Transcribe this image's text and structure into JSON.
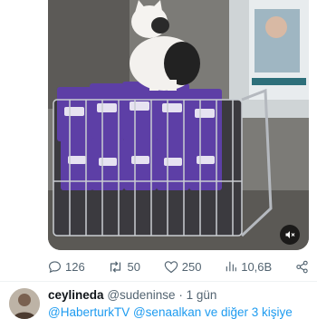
{
  "tweet": {
    "media": {
      "kind": "video",
      "scene": "cat-on-shopping-cart"
    },
    "actions": {
      "replies": "126",
      "reposts": "50",
      "likes": "250",
      "views": "10,6B"
    }
  },
  "reply": {
    "display_name": "ceylineda",
    "handle": "@sudeninse",
    "separator": "·",
    "time": "1 gün",
    "mentions": "@HaberturkTV @senaalkan ve diğer 3 kişiye"
  },
  "colors": {
    "muted": "#536471",
    "link": "#1d9bf0",
    "text": "#0f1419"
  }
}
